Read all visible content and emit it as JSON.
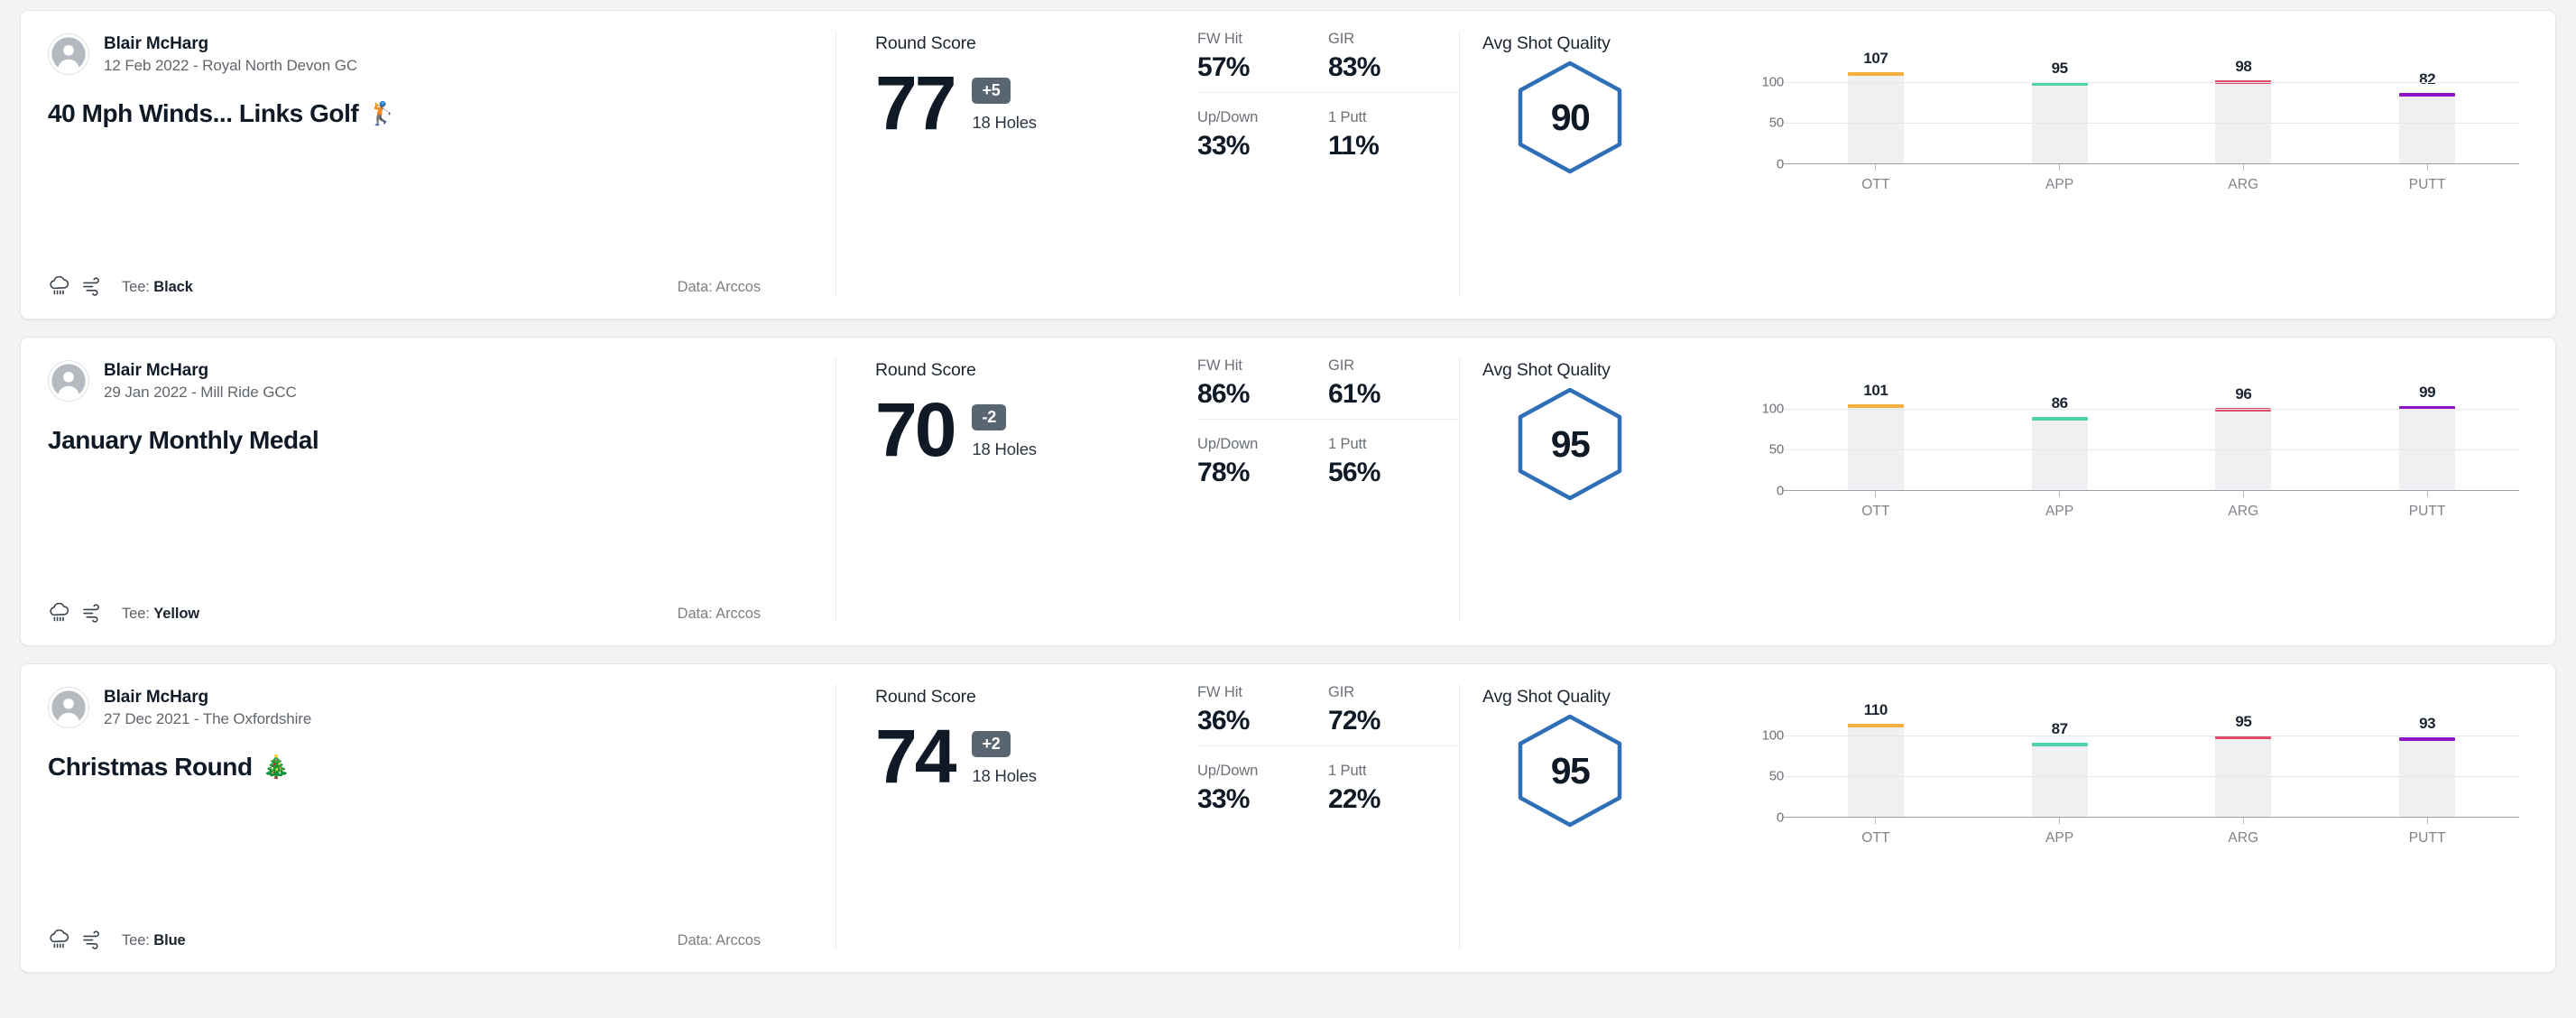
{
  "theme": {
    "page_background": "#f1f3f5",
    "card_background": "#ffffff",
    "accent_blue": "#2f6fb8",
    "badge_background": "#5a6572",
    "bar_fill": "#eff0f1"
  },
  "chart_legend": {
    "categories": [
      "OTT",
      "APP",
      "ARG",
      "PUTT"
    ],
    "colors": [
      "#f0b13f",
      "#4fd1aa",
      "#e04a69",
      "#9013c7"
    ],
    "y_ticks": [
      "100",
      "50",
      "0"
    ]
  },
  "labels": {
    "round_score": "Round Score",
    "holes": "18 Holes",
    "avg_shot_quality": "Avg Shot Quality",
    "fw_hit": "FW Hit",
    "gir": "GIR",
    "up_down": "Up/Down",
    "one_putt": "1 Putt",
    "tee_prefix": "Tee: ",
    "data_source": "Data: Arccos"
  },
  "rounds": [
    {
      "player": "Blair McHarg",
      "date_course": "12 Feb 2022 - Royal North Devon GC",
      "title": "40 Mph Winds... Links Golf",
      "title_emoji": "🏌️",
      "tee": "Black",
      "data_source": "Data: Arccos",
      "score": "77",
      "to_par": "+5",
      "holes": "18 Holes",
      "stats": {
        "fw_hit": "57%",
        "gir": "83%",
        "up_down": "33%",
        "one_putt": "11%"
      },
      "avg_shot_quality": "90",
      "chart_data": {
        "type": "bar",
        "title": "Avg Shot Quality",
        "categories": [
          "OTT",
          "APP",
          "ARG",
          "PUTT"
        ],
        "values": [
          107,
          95,
          98,
          82
        ],
        "colors": [
          "#f0b13f",
          "#4fd1aa",
          "#e04a69",
          "#9013c7"
        ],
        "ylim": [
          0,
          125
        ],
        "yticks": [
          0,
          50,
          100
        ],
        "xlabel": "",
        "ylabel": "",
        "grid": true,
        "legend": "none"
      }
    },
    {
      "player": "Blair McHarg",
      "date_course": "29 Jan 2022 - Mill Ride GCC",
      "title": "January Monthly Medal",
      "title_emoji": "",
      "tee": "Yellow",
      "data_source": "Data: Arccos",
      "score": "70",
      "to_par": "-2",
      "holes": "18 Holes",
      "stats": {
        "fw_hit": "86%",
        "gir": "61%",
        "up_down": "78%",
        "one_putt": "56%"
      },
      "avg_shot_quality": "95",
      "chart_data": {
        "type": "bar",
        "title": "Avg Shot Quality",
        "categories": [
          "OTT",
          "APP",
          "ARG",
          "PUTT"
        ],
        "values": [
          101,
          86,
          96,
          99
        ],
        "colors": [
          "#f0b13f",
          "#4fd1aa",
          "#e04a69",
          "#9013c7"
        ],
        "ylim": [
          0,
          125
        ],
        "yticks": [
          0,
          50,
          100
        ],
        "xlabel": "",
        "ylabel": "",
        "grid": true,
        "legend": "none"
      }
    },
    {
      "player": "Blair McHarg",
      "date_course": "27 Dec 2021 - The Oxfordshire",
      "title": "Christmas Round",
      "title_emoji": "🎄",
      "tee": "Blue",
      "data_source": "Data: Arccos",
      "score": "74",
      "to_par": "+2",
      "holes": "18 Holes",
      "stats": {
        "fw_hit": "36%",
        "gir": "72%",
        "up_down": "33%",
        "one_putt": "22%"
      },
      "avg_shot_quality": "95",
      "chart_data": {
        "type": "bar",
        "title": "Avg Shot Quality",
        "categories": [
          "OTT",
          "APP",
          "ARG",
          "PUTT"
        ],
        "values": [
          110,
          87,
          95,
          93
        ],
        "colors": [
          "#f0b13f",
          "#4fd1aa",
          "#e04a69",
          "#9013c7"
        ],
        "ylim": [
          0,
          125
        ],
        "yticks": [
          0,
          50,
          100
        ],
        "xlabel": "",
        "ylabel": "",
        "grid": true,
        "legend": "none"
      }
    }
  ]
}
